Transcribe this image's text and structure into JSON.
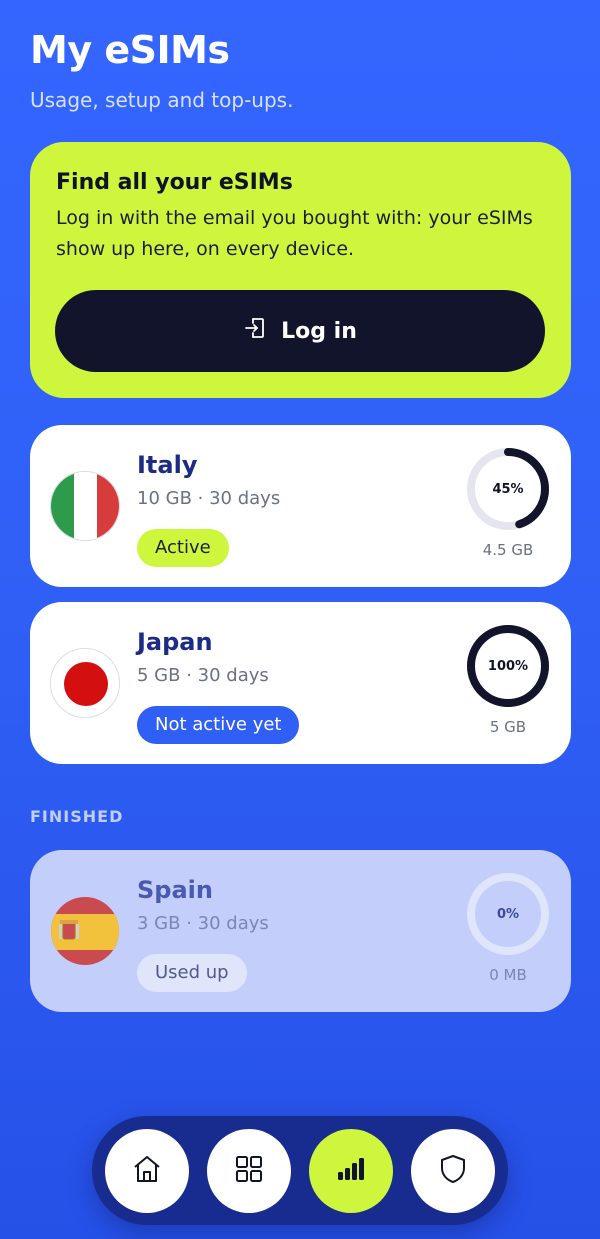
{
  "header": {
    "title": "My eSIMs",
    "subtitle": "Usage, setup and top-ups."
  },
  "login_card": {
    "title": "Find all your eSIMs",
    "text": "Log in with the email you bought with: your eSIMs show up here, on every device.",
    "button_label": "Log in",
    "button_icon": "login-icon"
  },
  "active_esims": [
    {
      "country": "Italy",
      "plan": "10 GB · 30 days",
      "status": "Active",
      "usage_percent": 45,
      "usage_label": "45%",
      "amount": "4.5 GB",
      "flag": "italy-flag"
    },
    {
      "country": "Japan",
      "plan": "5 GB · 30 days",
      "status": "Not active yet",
      "usage_percent": 100,
      "usage_label": "100%",
      "amount": "5 GB",
      "flag": "japan-flag"
    }
  ],
  "finished_section": {
    "label": "FINISHED",
    "esims": [
      {
        "country": "Spain",
        "plan": "3 GB · 30 days",
        "status": "Used up",
        "usage_percent": 0,
        "usage_label": "0%",
        "amount": "0 MB",
        "flag": "spain-flag"
      }
    ]
  },
  "tab_bar": {
    "tabs": [
      {
        "name": "home",
        "icon": "home-icon",
        "active": false
      },
      {
        "name": "store",
        "icon": "grid-icon",
        "active": false
      },
      {
        "name": "esims",
        "icon": "signal-bars-icon",
        "active": true
      },
      {
        "name": "security",
        "icon": "shield-icon",
        "active": false
      }
    ]
  },
  "colors": {
    "background": "#3466ff",
    "accent_lime": "#cef63c",
    "dark": "#11142a",
    "blue_badge": "#2f5ff5",
    "finished_card": "#c3cefb"
  }
}
